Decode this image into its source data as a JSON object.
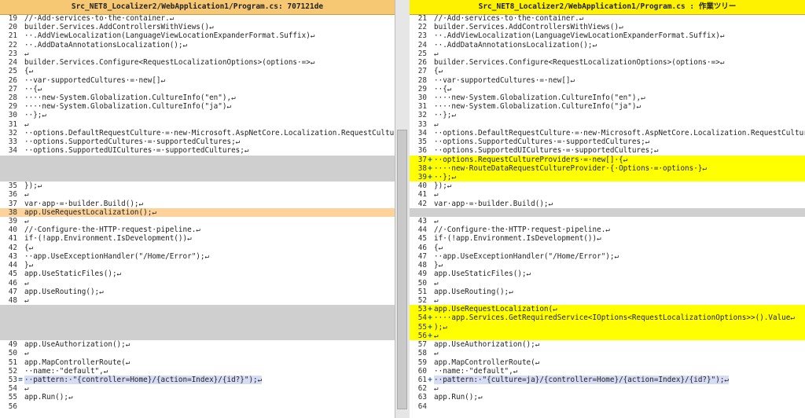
{
  "left": {
    "title": "Src_NET8_Localizer2/WebApplication1/Program.cs:  707121de",
    "rows": [
      {
        "n": "19",
        "t": "//·Add·services·to·the·container.↵",
        "k": ""
      },
      {
        "n": "20",
        "t": "builder.Services.AddControllersWithViews()↵",
        "k": ""
      },
      {
        "n": "21",
        "t": "··.AddViewLocalization(LanguageViewLocationExpanderFormat.Suffix)↵",
        "k": ""
      },
      {
        "n": "22",
        "t": "··.AddDataAnnotationsLocalization();↵",
        "k": ""
      },
      {
        "n": "23",
        "t": "↵",
        "k": ""
      },
      {
        "n": "24",
        "t": "builder.Services.Configure<RequestLocalizationOptions>(options·=>↵",
        "k": ""
      },
      {
        "n": "25",
        "t": "{↵",
        "k": ""
      },
      {
        "n": "26",
        "t": "··var·supportedCultures·=·new[]↵",
        "k": ""
      },
      {
        "n": "27",
        "t": "··{↵",
        "k": ""
      },
      {
        "n": "28",
        "t": "····new·System.Globalization.CultureInfo(\"en\"),↵",
        "k": ""
      },
      {
        "n": "29",
        "t": "····new·System.Globalization.CultureInfo(\"ja\")↵",
        "k": ""
      },
      {
        "n": "30",
        "t": "··};↵",
        "k": ""
      },
      {
        "n": "31",
        "t": "↵",
        "k": ""
      },
      {
        "n": "32",
        "t": "··options.DefaultRequestCulture·=·new·Microsoft.AspNetCore.Localization.RequestCulture(\"ja\")",
        "k": ""
      },
      {
        "n": "33",
        "t": "··options.SupportedCultures·=·supportedCultures;↵",
        "k": ""
      },
      {
        "n": "34",
        "t": "··options.SupportedUICultures·=·supportedCultures;↵",
        "k": ""
      },
      {
        "n": "",
        "t": "",
        "k": "gap"
      },
      {
        "n": "",
        "t": "",
        "k": "gap"
      },
      {
        "n": "",
        "t": "",
        "k": "gap"
      },
      {
        "n": "35",
        "t": "});↵",
        "k": ""
      },
      {
        "n": "36",
        "t": "↵",
        "k": ""
      },
      {
        "n": "37",
        "t": "var·app·=·builder.Build();↵",
        "k": ""
      },
      {
        "n": "38",
        "t": "app.UseRequestLocalization();↵",
        "k": "changed"
      },
      {
        "n": "39",
        "t": "↵",
        "k": ""
      },
      {
        "n": "40",
        "t": "//·Configure·the·HTTP·request·pipeline.↵",
        "k": ""
      },
      {
        "n": "41",
        "t": "if·(!app.Environment.IsDevelopment())↵",
        "k": ""
      },
      {
        "n": "42",
        "t": "{↵",
        "k": ""
      },
      {
        "n": "43",
        "t": "··app.UseExceptionHandler(\"/Home/Error\");↵",
        "k": ""
      },
      {
        "n": "44",
        "t": "}↵",
        "k": ""
      },
      {
        "n": "45",
        "t": "app.UseStaticFiles();↵",
        "k": ""
      },
      {
        "n": "46",
        "t": "↵",
        "k": ""
      },
      {
        "n": "47",
        "t": "app.UseRouting();↵",
        "k": ""
      },
      {
        "n": "48",
        "t": "↵",
        "k": ""
      },
      {
        "n": "",
        "t": "",
        "k": "gap"
      },
      {
        "n": "",
        "t": "",
        "k": "gap"
      },
      {
        "n": "",
        "t": "",
        "k": "gap"
      },
      {
        "n": "",
        "t": "",
        "k": "gap"
      },
      {
        "n": "49",
        "t": "app.UseAuthorization();↵",
        "k": ""
      },
      {
        "n": "50",
        "t": "↵",
        "k": ""
      },
      {
        "n": "51",
        "t": "app.MapControllerRoute(↵",
        "k": ""
      },
      {
        "n": "52",
        "t": "··name:·\"default\",↵",
        "k": ""
      },
      {
        "n": "53",
        "t": "··pattern:·\"{controller=Home}/{action=Index}/{id?}\");↵",
        "k": "sel",
        "m": "="
      },
      {
        "n": "54",
        "t": "↵",
        "k": ""
      },
      {
        "n": "55",
        "t": "app.Run();↵",
        "k": ""
      },
      {
        "n": "56",
        "t": "",
        "k": ""
      }
    ]
  },
  "right": {
    "title": "Src_NET8_Localizer2/WebApplication1/Program.cs : 作業ツリー",
    "rows": [
      {
        "n": "21",
        "t": "//·Add·services·to·the·container.↵",
        "k": ""
      },
      {
        "n": "22",
        "t": "builder.Services.AddControllersWithViews()↵",
        "k": ""
      },
      {
        "n": "23",
        "t": "··.AddViewLocalization(LanguageViewLocationExpanderFormat.Suffix)↵",
        "k": ""
      },
      {
        "n": "24",
        "t": "··.AddDataAnnotationsLocalization();↵",
        "k": ""
      },
      {
        "n": "25",
        "t": "↵",
        "k": ""
      },
      {
        "n": "26",
        "t": "builder.Services.Configure<RequestLocalizationOptions>(options·=>↵",
        "k": ""
      },
      {
        "n": "27",
        "t": "{↵",
        "k": ""
      },
      {
        "n": "28",
        "t": "··var·supportedCultures·=·new[]↵",
        "k": ""
      },
      {
        "n": "29",
        "t": "··{↵",
        "k": ""
      },
      {
        "n": "30",
        "t": "····new·System.Globalization.CultureInfo(\"en\"),↵",
        "k": ""
      },
      {
        "n": "31",
        "t": "····new·System.Globalization.CultureInfo(\"ja\")↵",
        "k": ""
      },
      {
        "n": "32",
        "t": "··};↵",
        "k": ""
      },
      {
        "n": "33",
        "t": "↵",
        "k": ""
      },
      {
        "n": "34",
        "t": "··options.DefaultRequestCulture·=·new·Microsoft.AspNetCore.Localization.RequestCulture(\"ja\")",
        "k": ""
      },
      {
        "n": "35",
        "t": "··options.SupportedCultures·=·supportedCultures;↵",
        "k": ""
      },
      {
        "n": "36",
        "t": "··options.SupportedUICultures·=·supportedCultures;↵",
        "k": ""
      },
      {
        "n": "37",
        "t": "··options.RequestCultureProviders·=·new[]·{↵",
        "k": "added",
        "m": "+"
      },
      {
        "n": "38",
        "t": "····new·RouteDataRequestCultureProvider·{·Options·=·options·}↵",
        "k": "added",
        "m": "+"
      },
      {
        "n": "39",
        "t": "··};↵",
        "k": "added",
        "m": "+"
      },
      {
        "n": "40",
        "t": "});↵",
        "k": ""
      },
      {
        "n": "41",
        "t": "↵",
        "k": ""
      },
      {
        "n": "42",
        "t": "var·app·=·builder.Build();↵",
        "k": ""
      },
      {
        "n": "",
        "t": "",
        "k": "gap"
      },
      {
        "n": "43",
        "t": "↵",
        "k": ""
      },
      {
        "n": "44",
        "t": "//·Configure·the·HTTP·request·pipeline.↵",
        "k": ""
      },
      {
        "n": "45",
        "t": "if·(!app.Environment.IsDevelopment())↵",
        "k": ""
      },
      {
        "n": "46",
        "t": "{↵",
        "k": ""
      },
      {
        "n": "47",
        "t": "··app.UseExceptionHandler(\"/Home/Error\");↵",
        "k": ""
      },
      {
        "n": "48",
        "t": "}↵",
        "k": ""
      },
      {
        "n": "49",
        "t": "app.UseStaticFiles();↵",
        "k": ""
      },
      {
        "n": "50",
        "t": "↵",
        "k": ""
      },
      {
        "n": "51",
        "t": "app.UseRouting();↵",
        "k": ""
      },
      {
        "n": "52",
        "t": "↵",
        "k": ""
      },
      {
        "n": "53",
        "t": "app.UseRequestLocalization(↵",
        "k": "added",
        "m": "+"
      },
      {
        "n": "54",
        "t": "····app.Services.GetRequiredService<IOptions<RequestLocalizationOptions>>().Value↵",
        "k": "added",
        "m": "+"
      },
      {
        "n": "55",
        "t": ");↵",
        "k": "added",
        "m": "+"
      },
      {
        "n": "56",
        "t": "↵",
        "k": "added",
        "m": "+"
      },
      {
        "n": "57",
        "t": "app.UseAuthorization();↵",
        "k": ""
      },
      {
        "n": "58",
        "t": "↵",
        "k": ""
      },
      {
        "n": "59",
        "t": "app.MapControllerRoute(↵",
        "k": ""
      },
      {
        "n": "60",
        "t": "··name:·\"default\",↵",
        "k": ""
      },
      {
        "n": "61",
        "t": "··pattern:·\"{culture=ja}/{controller=Home}/{action=Index}/{id?}\");↵",
        "k": "sel",
        "m": "+"
      },
      {
        "n": "62",
        "t": "↵",
        "k": ""
      },
      {
        "n": "63",
        "t": "app.Run();↵",
        "k": ""
      },
      {
        "n": "64",
        "t": "",
        "k": ""
      }
    ]
  },
  "colors": {
    "left_title_bg": "#f7c873",
    "right_title_bg": "#fff200",
    "added_bg": "#ffff00",
    "changed_bg": "#fdd39b",
    "gap_bg": "#cfcfcf",
    "selection_bg": "#d6dcf4"
  }
}
